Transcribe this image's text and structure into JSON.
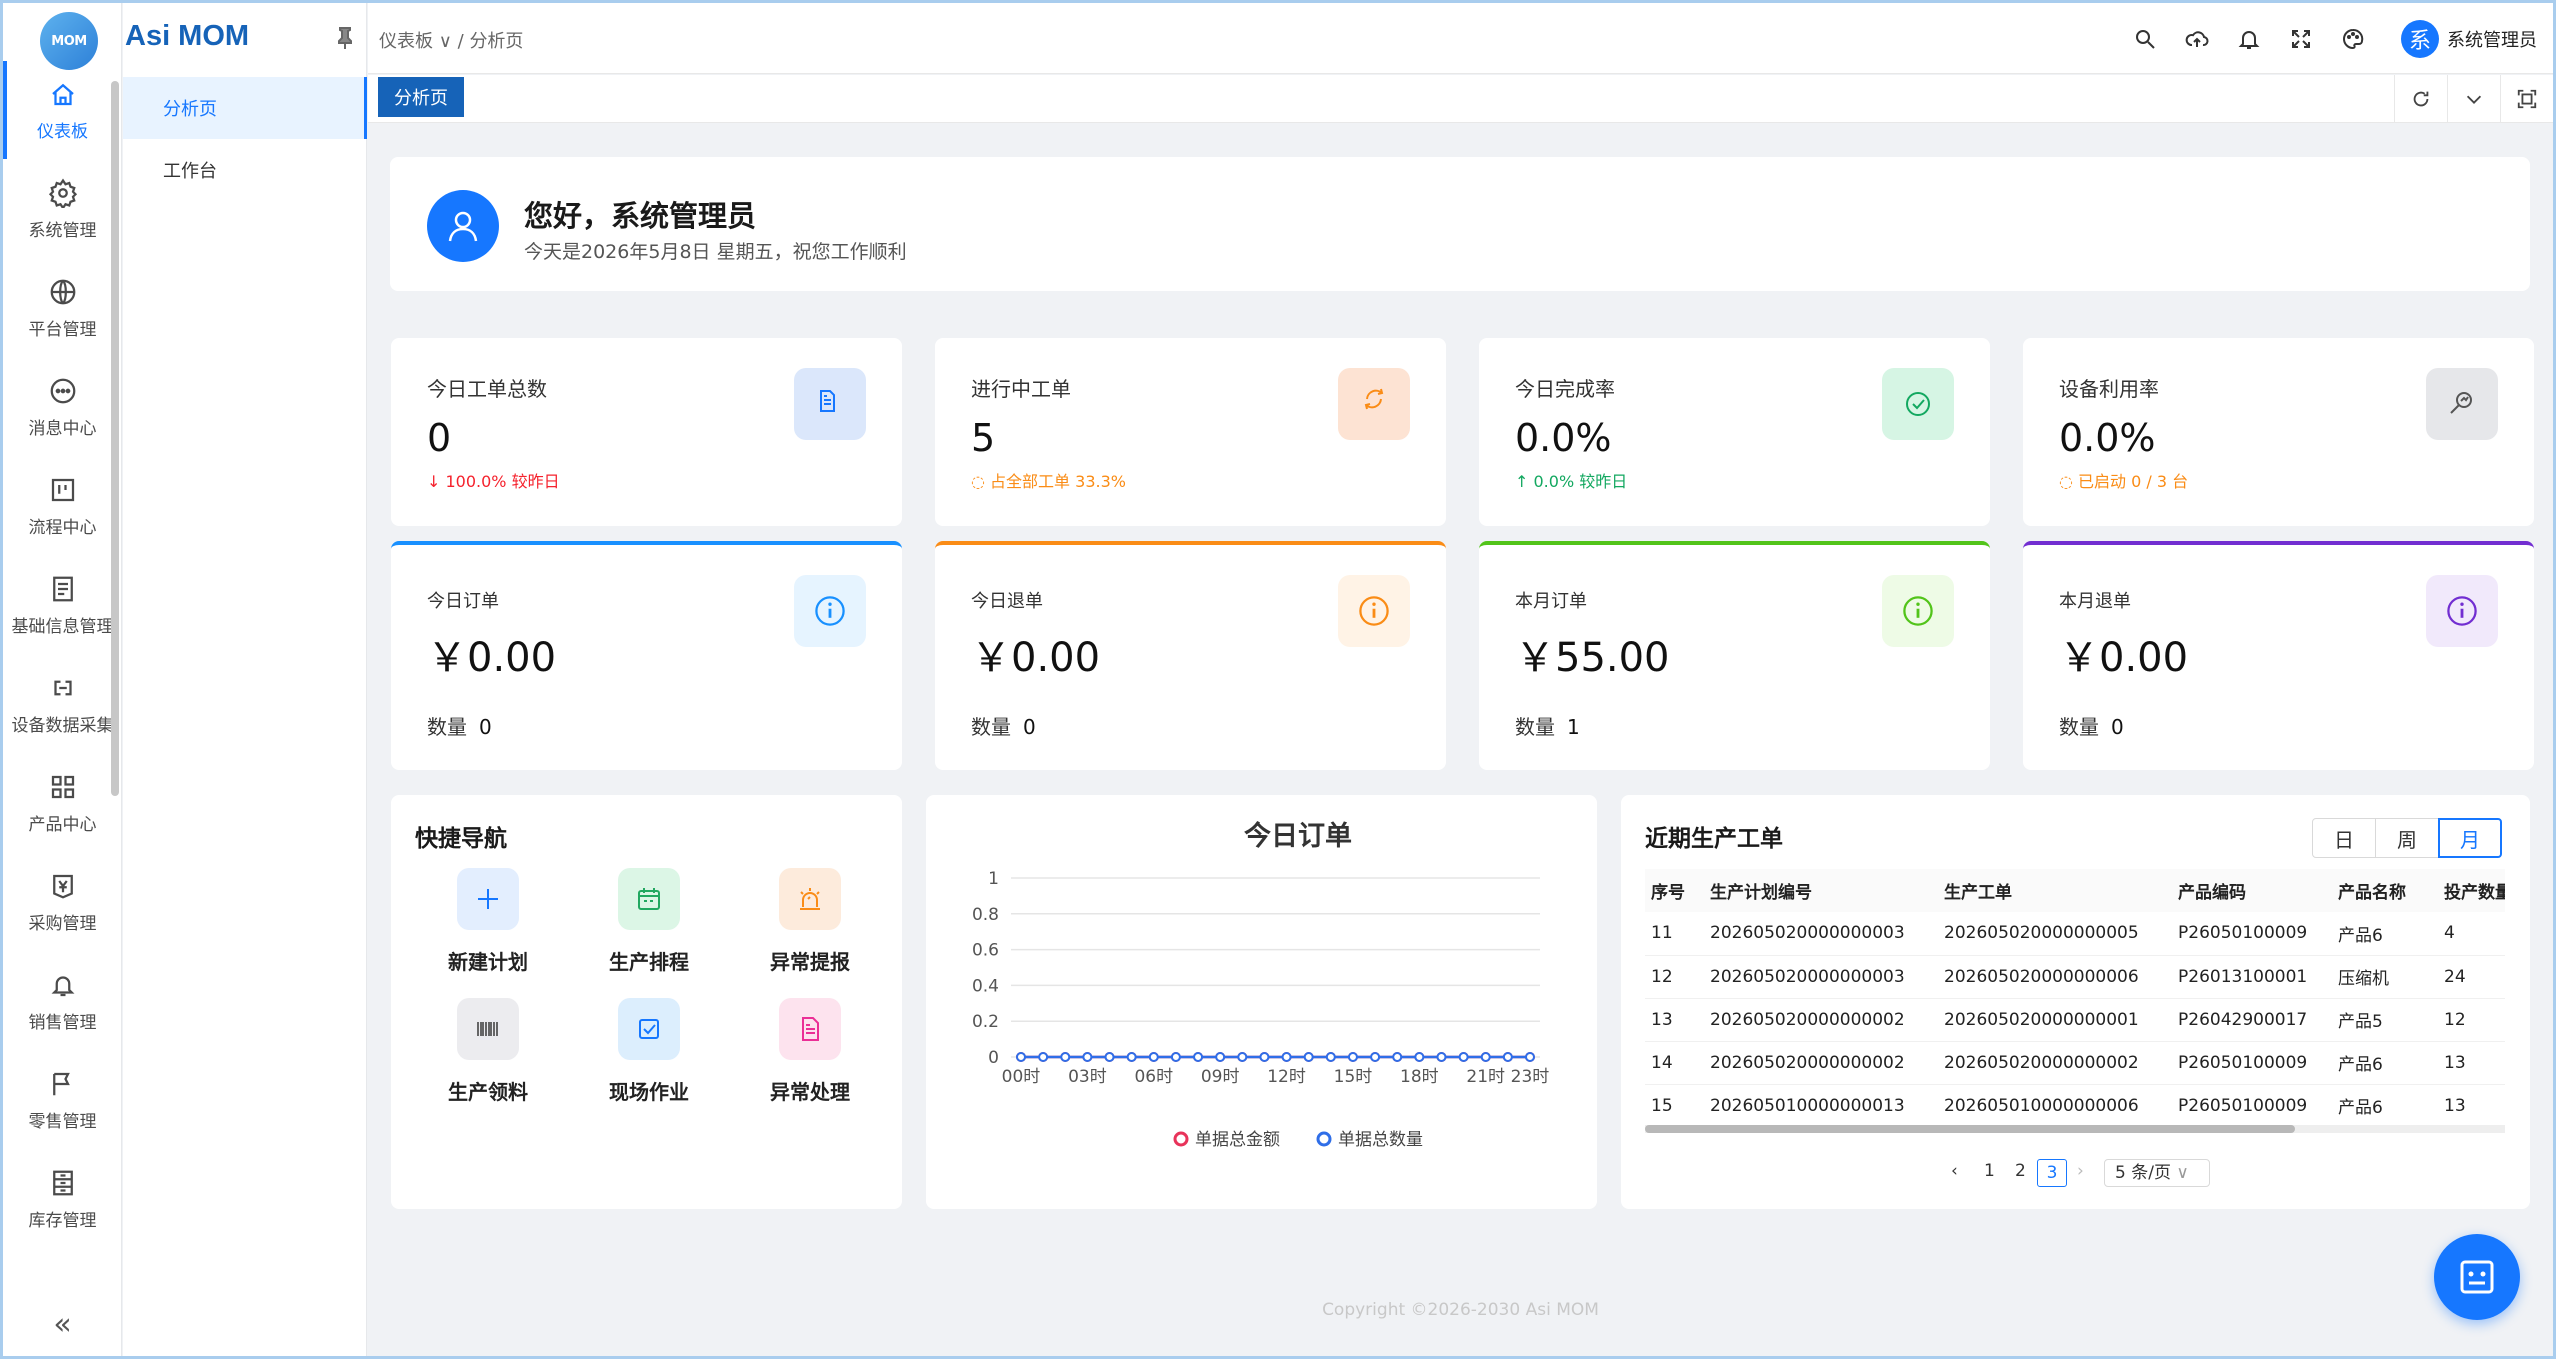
{
  "app": {
    "logo_text": "MOM",
    "brand": "Asi MOM"
  },
  "rail": {
    "items": [
      {
        "label": "仪表板",
        "icon": "home-icon"
      },
      {
        "label": "系统管理",
        "icon": "gear-icon"
      },
      {
        "label": "平台管理",
        "icon": "globe-icon"
      },
      {
        "label": "消息中心",
        "icon": "chat-icon"
      },
      {
        "label": "流程中心",
        "icon": "kanban-icon"
      },
      {
        "label": "基础信息管理",
        "icon": "doc-icon"
      },
      {
        "label": "设备数据采集",
        "icon": "link-icon"
      },
      {
        "label": "产品中心",
        "icon": "grid-icon"
      },
      {
        "label": "采购管理",
        "icon": "yen-icon"
      },
      {
        "label": "销售管理",
        "icon": "bell-icon"
      },
      {
        "label": "零售管理",
        "icon": "flag-icon"
      },
      {
        "label": "库存管理",
        "icon": "cabinet-icon"
      }
    ],
    "collapse": "«"
  },
  "submenu": {
    "items": [
      "分析页",
      "工作台"
    ]
  },
  "breadcrumb": {
    "root": "仪表板",
    "current": "分析页"
  },
  "user": {
    "avatar": "系",
    "name": "系统管理员"
  },
  "tabs": {
    "active": "分析页"
  },
  "welcome": {
    "title": "您好，系统管理员",
    "date": "今天是2026年5月8日 星期五，祝您工作顺利"
  },
  "stats": [
    {
      "label": "今日工单总数",
      "value": "0",
      "sub": "↓ 100.0% 较昨日",
      "sub_color": "#f5222d",
      "icon_color": "#1677ff",
      "bg": "#dbe7fb"
    },
    {
      "label": "进行中工单",
      "value": "5",
      "sub": "◌ 占全部工单 33.3%",
      "sub_color": "#fa8c16",
      "icon_color": "#fa8c16",
      "bg": "#fde3d3"
    },
    {
      "label": "今日完成率",
      "value": "0.0%",
      "sub": "↑ 0.0% 较昨日",
      "sub_color": "#13a860",
      "icon_color": "#13a860",
      "bg": "#d6f5e4"
    },
    {
      "label": "设备利用率",
      "value": "0.0%",
      "sub": "◌ 已启动 0 / 3 台",
      "sub_color": "#fa8c16",
      "icon_color": "#555",
      "bg": "#e6e7ea"
    }
  ],
  "money": [
    {
      "label": "今日订单",
      "value": "￥0.00",
      "qty_label": "数量",
      "qty": "0",
      "color": "#1890ff",
      "bg": "#e6f4ff"
    },
    {
      "label": "今日退单",
      "value": "￥0.00",
      "qty_label": "数量",
      "qty": "0",
      "color": "#fa8c16",
      "bg": "#fff3e6"
    },
    {
      "label": "本月订单",
      "value": "￥55.00",
      "qty_label": "数量",
      "qty": "1",
      "color": "#52c41a",
      "bg": "#eefbe6"
    },
    {
      "label": "本月退单",
      "value": "￥0.00",
      "qty_label": "数量",
      "qty": "0",
      "color": "#722ed1",
      "bg": "#f1e9fb"
    }
  ],
  "quicknav": {
    "title": "快捷导航",
    "items": [
      {
        "label": "新建计划",
        "icon": "plus-icon",
        "color": "#1677ff",
        "bg": "#e3eefe"
      },
      {
        "label": "生产排程",
        "icon": "calendar-icon",
        "color": "#22a861",
        "bg": "#dcf6e6"
      },
      {
        "label": "异常提报",
        "icon": "alarm-icon",
        "color": "#fa8c16",
        "bg": "#fdebdc"
      },
      {
        "label": "生产领料",
        "icon": "barcode-icon",
        "color": "#666",
        "bg": "#ececef"
      },
      {
        "label": "现场作业",
        "icon": "checkbox-icon",
        "color": "#1677ff",
        "bg": "#dceefd"
      },
      {
        "label": "异常处理",
        "icon": "file-icon",
        "color": "#eb2f96",
        "bg": "#fde3ee"
      }
    ]
  },
  "chart_data": {
    "type": "line",
    "title": "今日订单",
    "x": [
      "00时",
      "01时",
      "02时",
      "03时",
      "04时",
      "05时",
      "06时",
      "07时",
      "08时",
      "09时",
      "10时",
      "11时",
      "12时",
      "13时",
      "14时",
      "15时",
      "16时",
      "17时",
      "18时",
      "19时",
      "20时",
      "21时",
      "22时",
      "23时"
    ],
    "x_tick_labels": [
      "00时",
      "03时",
      "06时",
      "09时",
      "12时",
      "15时",
      "18时",
      "21时",
      "23时"
    ],
    "y_ticks": [
      "0",
      "0.2",
      "0.4",
      "0.6",
      "0.8",
      "1"
    ],
    "ylim": [
      0,
      1
    ],
    "grid": true,
    "legend_position": "bottom",
    "series": [
      {
        "name": "单据总金额",
        "color": "#e8335a",
        "values": [
          0,
          0,
          0,
          0,
          0,
          0,
          0,
          0,
          0,
          0,
          0,
          0,
          0,
          0,
          0,
          0,
          0,
          0,
          0,
          0,
          0,
          0,
          0,
          0
        ]
      },
      {
        "name": "单据总数量",
        "color": "#2f6ee8",
        "values": [
          0,
          0,
          0,
          0,
          0,
          0,
          0,
          0,
          0,
          0,
          0,
          0,
          0,
          0,
          0,
          0,
          0,
          0,
          0,
          0,
          0,
          0,
          0,
          0
        ]
      }
    ]
  },
  "workorders": {
    "title": "近期生产工单",
    "periods": [
      "日",
      "周",
      "月"
    ],
    "active_period": "月",
    "columns": [
      "序号",
      "生产计划编号",
      "生产工单",
      "产品编码",
      "产品名称",
      "投产数量"
    ],
    "rows": [
      [
        "11",
        "202605020000000003",
        "202605020000000005",
        "P26050100009",
        "产品6",
        "4"
      ],
      [
        "12",
        "202605020000000003",
        "202605020000000006",
        "P26013100001",
        "压缩机",
        "24"
      ],
      [
        "13",
        "202605020000000002",
        "202605020000000001",
        "P26042900017",
        "产品5",
        "12"
      ],
      [
        "14",
        "202605020000000002",
        "202605020000000002",
        "P26050100009",
        "产品6",
        "13"
      ],
      [
        "15",
        "202605010000000013",
        "202605010000000006",
        "P26050100009",
        "产品6",
        "13"
      ]
    ],
    "pagination": {
      "pages": [
        "1",
        "2",
        "3"
      ],
      "current": "3",
      "page_size": "5 条/页"
    }
  },
  "footer": "Copyright ©2026-2030 Asi MOM"
}
